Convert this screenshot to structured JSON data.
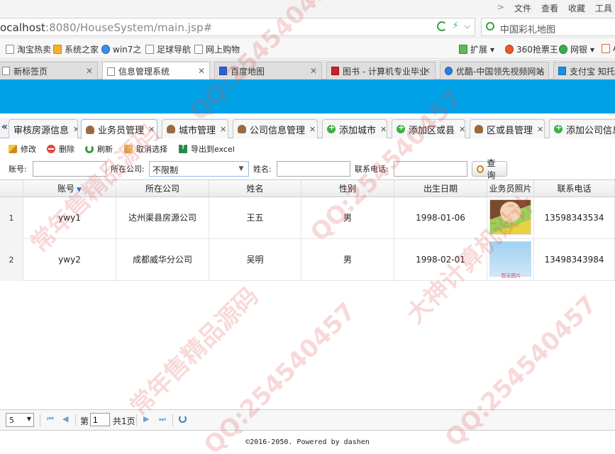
{
  "browser": {
    "menu": [
      "文件",
      "查看",
      "收藏",
      "工具"
    ],
    "menu_chevron": ">",
    "url_host": "ocalhost",
    "url_path": ":8080/HouseSystem/main.jsp#",
    "search_text": "中国彩礼地图",
    "bookmarks": [
      "淘宝热卖",
      "系统之家",
      "win7之",
      "足球导航",
      "网上购物",
      "扩展",
      "360抢票王",
      "网银",
      "Ao"
    ],
    "tabs": [
      {
        "label": "新标签页"
      },
      {
        "label": "信息管理系统"
      },
      {
        "label": "百度地图"
      },
      {
        "label": "图书 - 计算机专业毕业"
      },
      {
        "label": "优酷-中国领先视频网站"
      },
      {
        "label": "支付宝 知托付"
      }
    ]
  },
  "app": {
    "tabs": [
      {
        "label": "审核房源信息"
      },
      {
        "label": "业务员管理"
      },
      {
        "label": "城市管理"
      },
      {
        "label": "公司信息管理"
      },
      {
        "label": "添加城市"
      },
      {
        "label": "添加区或县"
      },
      {
        "label": "区或县管理"
      },
      {
        "label": "添加公司信息"
      }
    ],
    "toolbar": {
      "edit": "修改",
      "delete": "删除",
      "refresh": "刷新",
      "cancel_select": "取消选择",
      "export": "导出到excel"
    },
    "filter": {
      "account_label": "账号:",
      "company_label": "所在公司:",
      "company_value": "不限制",
      "name_label": "姓名:",
      "phone_label": "联系电话:",
      "search_btn": "查询"
    },
    "grid": {
      "columns": [
        "账号",
        "所在公司",
        "姓名",
        "性别",
        "出生日期",
        "业务员照片",
        "联系电话"
      ],
      "rows": [
        {
          "rownum": "1",
          "account": "ywy1",
          "company": "达州渠县房源公司",
          "name": "王五",
          "gender": "男",
          "birth": "1998-01-06",
          "phone": "13598343534"
        },
        {
          "rownum": "2",
          "account": "ywy2",
          "company": "成都威华分公司",
          "name": "吴明",
          "gender": "男",
          "birth": "1998-02-01",
          "phone": "13498343984",
          "photo_caption": "暂无图片"
        }
      ]
    },
    "pager": {
      "page_size": "5",
      "page_prefix": "第",
      "page_number": "1",
      "page_total": "共1页"
    },
    "footer": "©2016-2050. Powered by dashen"
  },
  "watermarks": [
    "QQ:254540457",
    "常年售精品源码",
    "大神计算机设计"
  ],
  "colors": {
    "banner": "#00a1e6",
    "watermark": "#e15050"
  }
}
